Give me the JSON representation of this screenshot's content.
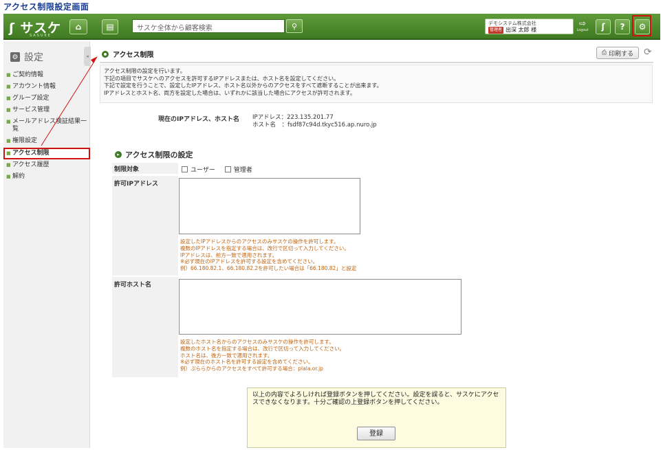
{
  "page_caption": "アクセス制限設定画面",
  "header": {
    "logo": "サスケ",
    "logo_sub": "SASUKE",
    "search_placeholder": "サスケ全体から顧客検索",
    "company": "デモシステム株式会社",
    "role_badge": "管理者",
    "user_name": "出深 太郎 様",
    "logout_label": "Logout",
    "help_label": "?"
  },
  "sidebar": {
    "title": "設定",
    "items": [
      {
        "label": "ご契約情報"
      },
      {
        "label": "アカウント情報"
      },
      {
        "label": "グループ設定"
      },
      {
        "label": "サービス管理"
      },
      {
        "label": "メールアドレス検証結果一覧"
      },
      {
        "label": "権限設定"
      },
      {
        "label": "アクセス制限",
        "active": true
      },
      {
        "label": "アクセス履歴"
      },
      {
        "label": "解約"
      }
    ]
  },
  "main": {
    "section_title": "アクセス制限",
    "print_label": "印刷する",
    "description": [
      "アクセス制限の設定を行います。",
      "下記の項目でサスケへのアクセスを許可するIPアドレスまたは、ホスト名を設定してください。",
      "下記で設定を行うことで、設定したIPアドレス、ホスト名以外からのアクセスをすべて遮断することが出来ます。",
      "IPアドレスとホスト名、両方を設定した場合は、いずれかに該当した場合にアクセスが許可されます。"
    ],
    "current": {
      "label": "現在のIPアドレス、ホスト名",
      "ip_line": "IPアドレス：223.135.201.77",
      "host_line": "ホスト名　：fsdf87c94d.tkyc516.ap.nuro.jp"
    },
    "settings_title": "アクセス制限の設定",
    "target_label": "制限対象",
    "target_user": "ユーザー",
    "target_admin": "管理者",
    "ip_label": "許可IPアドレス",
    "ip_notes": [
      "設定したIPアドレスからのアクセスのみサスケの操作を許可します。",
      "複数のIPアドレスを指定する場合は、改行で区切って入力してください。",
      "IPアドレスは、前方一致で適用されます。",
      "※必ず現在のIPアドレスを許可する設定を含めてください。",
      "例）66.180.82.1、66.180.82.2を許可したい場合は「66.180.82」と設定"
    ],
    "host_label": "許可ホスト名",
    "host_notes": [
      "設定したホスト名からのアクセスのみサスケの操作を許可します。",
      "複数のホスト名を指定する場合は、改行で区切って入力してください。",
      "ホスト名は、後方一致で適用されます。",
      "※必ず現在のホスト名を許可する設定を含めてください。",
      "例）ぷららからのアクセスをすべて許可する場合：plala.or.jp"
    ],
    "confirm_text": "以上の内容でよろしければ登録ボタンを押してください。設定を誤ると、サスケにアクセスできなくなります。十分ご確認の上登録ボタンを押してください。",
    "register_label": "登録"
  },
  "colors": {
    "header_green": "#4d8a2a",
    "highlight_red": "#d31111",
    "note_orange": "#c0620e"
  }
}
